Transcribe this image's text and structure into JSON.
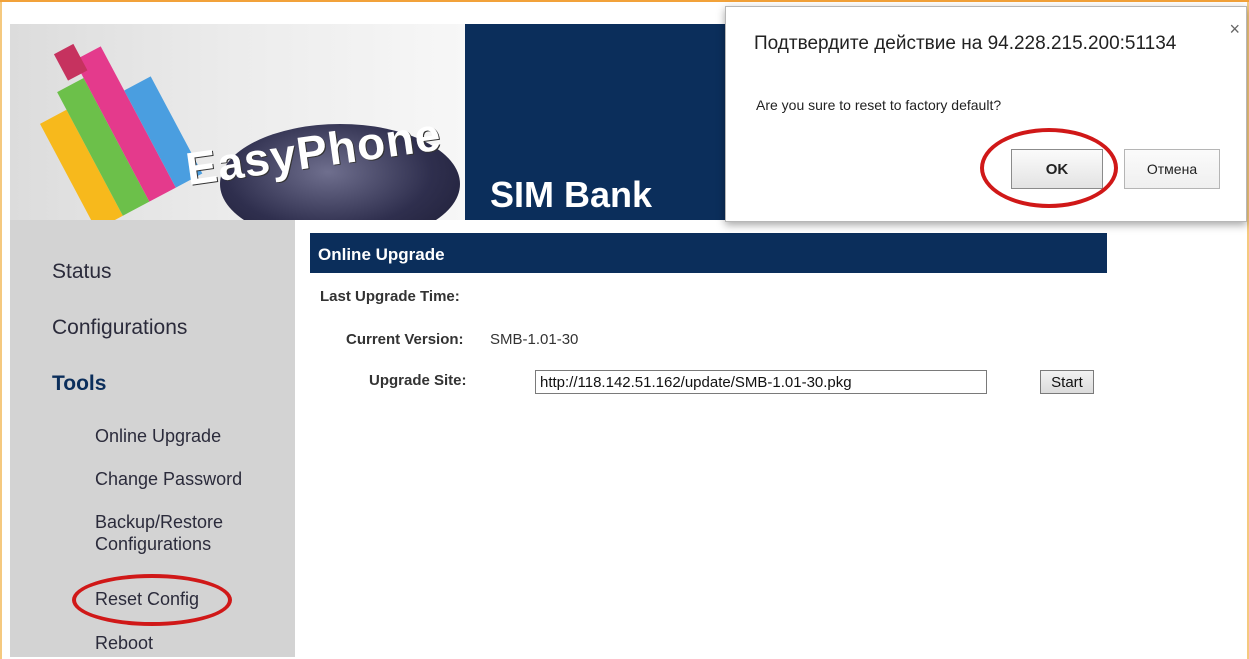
{
  "header": {
    "brand_name": "EasyPhone",
    "product_name": "SIM Bank"
  },
  "sidebar": {
    "items": [
      {
        "label": "Status"
      },
      {
        "label": "Configurations"
      },
      {
        "label": "Tools"
      }
    ],
    "tools_items": [
      {
        "label": "Online Upgrade"
      },
      {
        "label": "Change Password"
      },
      {
        "label": "Backup/Restore Configurations"
      },
      {
        "label": "Reset Config"
      },
      {
        "label": "Reboot"
      }
    ]
  },
  "main": {
    "section_title": "Online Upgrade",
    "last_upgrade_time_label": "Last Upgrade Time:",
    "last_upgrade_time_value": "",
    "current_version_label": "Current Version:",
    "current_version_value": "SMB-1.01-30",
    "upgrade_site_label": "Upgrade Site:",
    "upgrade_site_value": "http://118.142.51.162/update/SMB-1.01-30.pkg",
    "start_label": "Start"
  },
  "dialog": {
    "title": "Подтвердите действие на 94.228.215.200:51134",
    "message": "Are you sure to reset to factory default?",
    "ok_label": "OK",
    "cancel_label": "Отмена",
    "close_glyph": "×"
  },
  "colors": {
    "navy": "#0b2e5b",
    "sidebar_bg": "#d3d3d3",
    "annotation_red": "#d01818"
  }
}
